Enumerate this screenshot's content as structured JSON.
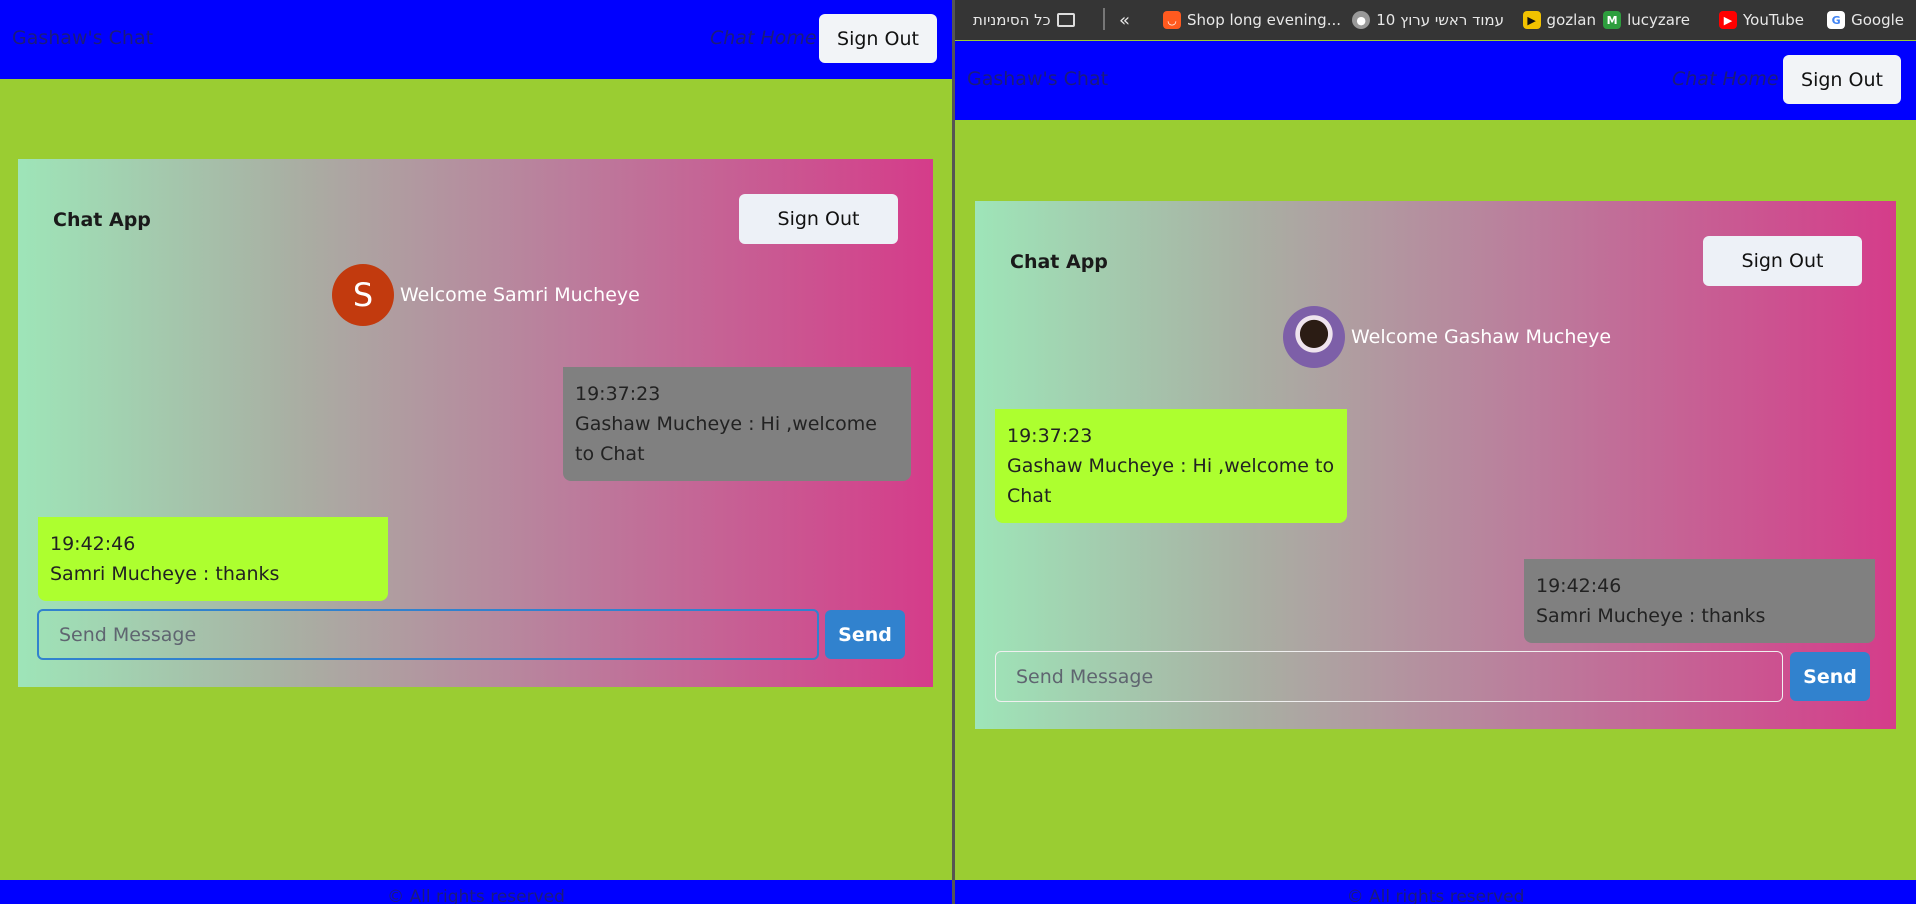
{
  "bookmarks": [
    {
      "label": "Google",
      "icon": "google-icon",
      "color": "#4285f4"
    },
    {
      "label": "YouTube",
      "icon": "youtube-icon",
      "color": "#ff0000"
    },
    {
      "label": "lucyzare",
      "icon": "m-logo-icon",
      "color": "#2e9e3e"
    },
    {
      "label": "gozlan",
      "icon": "play-icon",
      "color": "#f2c200"
    },
    {
      "label": "עמוד ראשי ערוץ 10",
      "icon": "football-icon",
      "color": "#888888"
    },
    {
      "label": "Shop long evening...",
      "icon": "shop-icon",
      "color": "#ff5a1f"
    }
  ],
  "bookmarks_all": "כל הסימניות",
  "left": {
    "brand": "Gashaw's Chat",
    "nav_link": "Chat Home",
    "nav_signout": "Sign Out",
    "card_title": "Chat App",
    "card_signout": "Sign Out",
    "avatar_letter": "S",
    "welcome": "Welcome Samri Mucheye",
    "messages": [
      {
        "time": "19:37:23",
        "text": "Gashaw Mucheye : Hi ,welcome to Chat"
      },
      {
        "time": "19:42:46",
        "text": "Samri Mucheye : thanks"
      }
    ],
    "input_placeholder": "Send Message",
    "send_label": "Send",
    "footer": "© All rights reserved"
  },
  "right": {
    "brand": "Gashaw's Chat",
    "nav_link": "Chat Home",
    "nav_signout": "Sign Out",
    "card_title": "Chat App",
    "card_signout": "Sign Out",
    "welcome": "Welcome Gashaw Mucheye",
    "messages": [
      {
        "time": "19:37:23",
        "text": "Gashaw Mucheye : Hi ,welcome to Chat"
      },
      {
        "time": "19:42:46",
        "text": "Samri Mucheye : thanks"
      }
    ],
    "input_placeholder": "Send Message",
    "send_label": "Send",
    "footer": "© All rights reserved"
  },
  "colors": {
    "navbar": "#0000ff",
    "page_bg": "#9acd32",
    "own_bubble": "#adff2f",
    "other_bubble": "#808080",
    "send_button": "#3182ce"
  }
}
